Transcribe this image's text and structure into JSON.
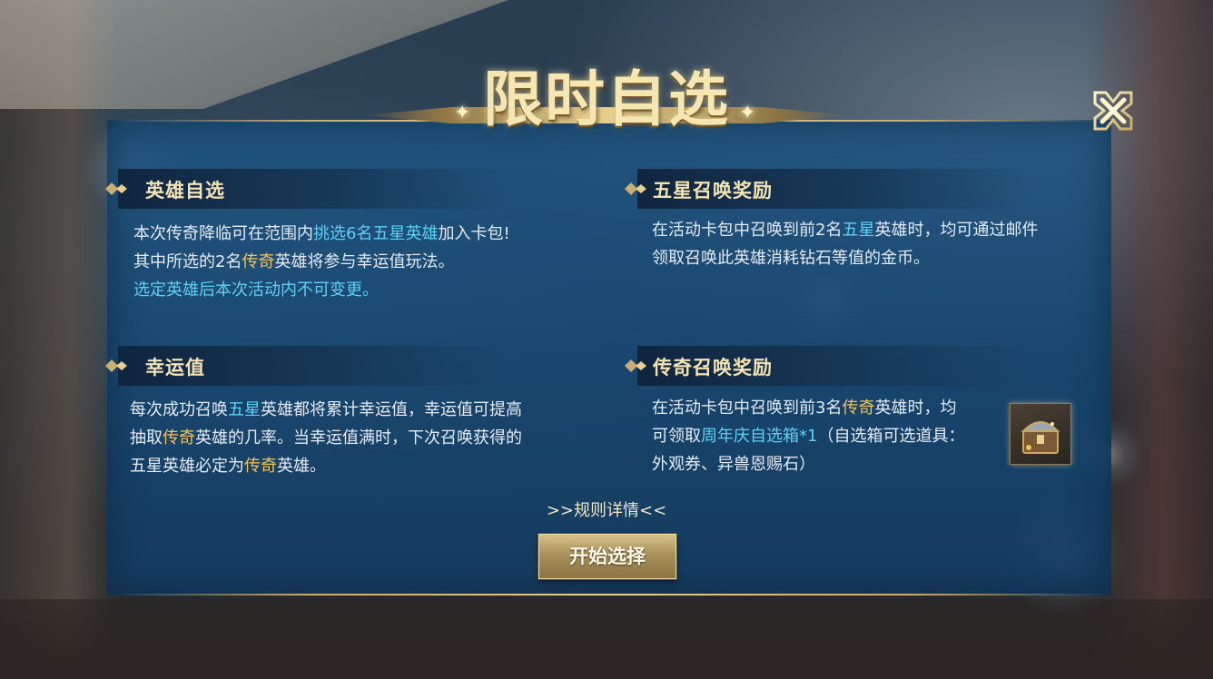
{
  "title": "限时自选",
  "sections": {
    "hero_select": {
      "title": "英雄自选",
      "line1_a": "本次传奇降临可在范围内",
      "line1_hl": "挑选6名五星英雄",
      "line1_b": "加入卡包!",
      "line2_a": "其中所选的2名",
      "line2_hl": "传奇",
      "line2_b": "英雄将参与幸运值玩法。",
      "line3_hl": "选定英雄后本次活动内不可变更。"
    },
    "five_star_reward": {
      "title": "五星召唤奖励",
      "line1_a": "在活动卡包中召唤到前2名",
      "line1_hl": "五星",
      "line1_b": "英雄时，均可通过邮件",
      "line2": "领取召唤此英雄消耗钻石等值的金币。"
    },
    "luck_value": {
      "title": "幸运值",
      "line1_a": "每次成功召唤",
      "line1_hl": "五星",
      "line1_b": "英雄都将累计幸运值，幸运值可提高",
      "line2_a": "抽取",
      "line2_hl": "传奇",
      "line2_b": "英雄的几率。当幸运值满时，下次召唤获得的",
      "line3_a": "五星英雄必定为",
      "line3_hl": "传奇",
      "line3_b": "英雄。"
    },
    "legend_reward": {
      "title": "传奇召唤奖励",
      "line1_a": "在活动卡包中召唤到前3名",
      "line1_hl": "传奇",
      "line1_b": "英雄时，均",
      "line2_a": "可领取",
      "line2_hl": "周年庆自选箱*1",
      "line2_b": "（自选箱可选道具：",
      "line3": "外观券、异兽恩赐石）"
    }
  },
  "rules_link": ">>规则详情<<",
  "start_button": "开始选择",
  "colors": {
    "highlight_blue": "#5fd0f4",
    "highlight_gold": "#f0c35a",
    "title_gold": "#f6e7b2",
    "panel_blue": "#1e5582"
  },
  "icons": {
    "close": "close-x-icon",
    "reward_item": "treasure-chest-icon",
    "section_marker": "diamond-ornament-icon"
  }
}
